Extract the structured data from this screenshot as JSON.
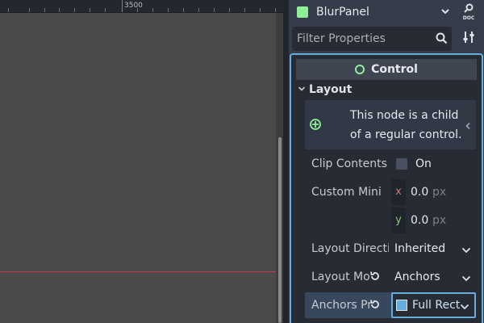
{
  "viewport": {
    "ruler_label": "3500"
  },
  "inspector": {
    "node_name": "BlurPanel",
    "doc_label": "DOC",
    "filter_placeholder": "Filter Properties",
    "category": "Control",
    "section": "Layout",
    "info_text": "This node is a child of a regular control.",
    "properties": {
      "clip_contents": {
        "label": "Clip Contents",
        "value": "On"
      },
      "custom_min": {
        "label": "Custom Mini",
        "x_axis": "x",
        "x_value": "0.0",
        "y_axis": "y",
        "y_value": "0.0",
        "unit": "px"
      },
      "layout_direction": {
        "label": "Layout Directi",
        "value": "Inherited"
      },
      "layout_mode": {
        "label": "Layout Mo",
        "value": "Anchors"
      },
      "anchors_preset": {
        "label": "Anchors Pr",
        "value": "Full Rect"
      }
    }
  },
  "colors": {
    "accent": "#67acdf",
    "control_green": "#8eef97",
    "guide_red": "#c0394b"
  }
}
